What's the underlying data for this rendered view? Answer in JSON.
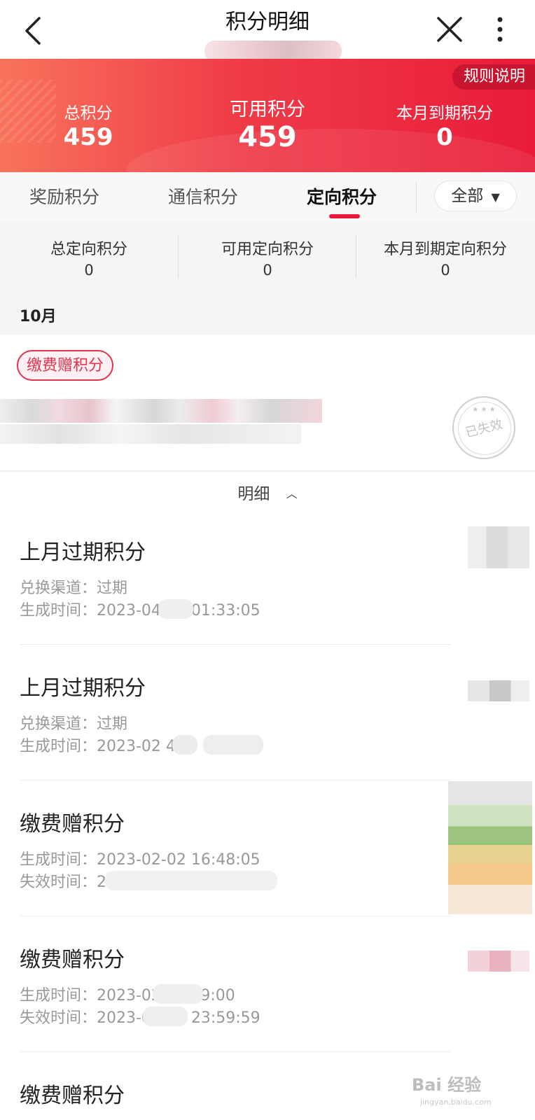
{
  "header": {
    "title": "积分明细"
  },
  "banner": {
    "rules_label": "规则说明",
    "total_label": "总积分",
    "total_value": "459",
    "available_label": "可用积分",
    "available_value": "459",
    "expiring_label": "本月到期积分",
    "expiring_value": "0"
  },
  "tabs": {
    "items": [
      {
        "label": "奖励积分"
      },
      {
        "label": "通信积分"
      },
      {
        "label": "定向积分"
      }
    ],
    "active_index": 2,
    "filter_label": "全部"
  },
  "substats": {
    "items": [
      {
        "label": "总定向积分",
        "value": "0"
      },
      {
        "label": "可用定向积分",
        "value": "0"
      },
      {
        "label": "本月到期定向积分",
        "value": "0"
      }
    ]
  },
  "month": "10月",
  "card": {
    "tag": "缴费赠积分",
    "stamp_text": "已失效",
    "stamp_stars": "★ ★ ★"
  },
  "toggle": {
    "label": "明细",
    "chevron": "︿"
  },
  "details": [
    {
      "title": "上月过期积分",
      "line1": "兑换渠道：过期",
      "line2": "生成时间：2023-04-06 01:33:05"
    },
    {
      "title": "上月过期积分",
      "line1": "兑换渠道：过期",
      "line2": "生成时间：2023-02          4"
    },
    {
      "title": "缴费赠积分",
      "line1": "生成时间：2023-02-02 16:48:05",
      "line2": "失效时间：2023-03-31 23:59:59"
    },
    {
      "title": "缴费赠积分",
      "line1": "生成时间：2023-02       14:29:00",
      "line2": "失效时间：2023-03-31 23:59:59"
    },
    {
      "title": "缴费赠积分"
    }
  ],
  "watermark": {
    "text": "Bai 经验",
    "sub": "jingyan.baidu.com"
  },
  "colors": {
    "brand_red": "#e8193a",
    "banner_left": "#f8735b",
    "banner_right": "#e91c38"
  }
}
